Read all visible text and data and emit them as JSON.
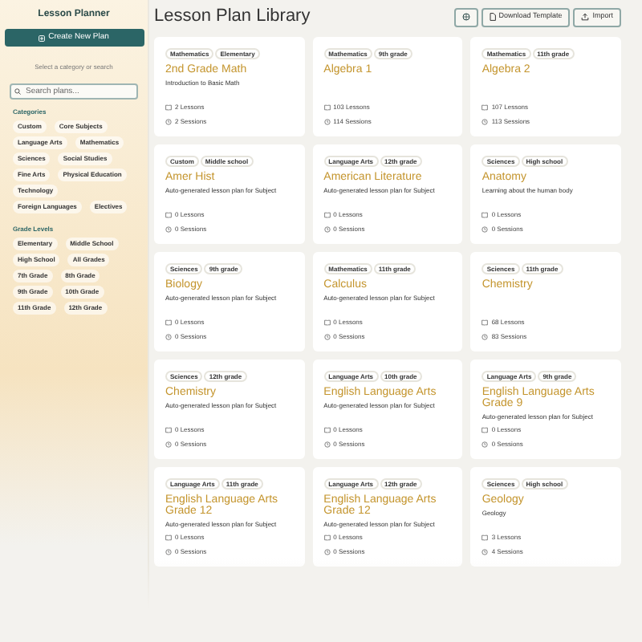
{
  "sidebar": {
    "title": "Lesson Planner",
    "create_button": "Create New Plan",
    "hint": "Select a category or search",
    "search": {
      "placeholder": "Search plans..."
    },
    "categories": {
      "heading": "Categories",
      "items": [
        "Custom",
        "Core Subjects",
        "Language Arts",
        "Mathematics",
        "Sciences",
        "Social Studies",
        "Fine Arts",
        "Physical Education",
        "Technology",
        "Foreign Languages",
        "Electives"
      ]
    },
    "grade_levels": {
      "heading": "Grade Levels",
      "items": [
        "Elementary",
        "Middle School",
        "High School",
        "All Grades",
        "7th Grade",
        "8th Grade",
        "9th Grade",
        "10th Grade",
        "11th Grade",
        "12th Grade"
      ]
    }
  },
  "header": {
    "title": "Lesson Plan Library",
    "buttons": [
      {
        "kind": "icon"
      },
      {
        "kind": "download",
        "label": "Download Template"
      },
      {
        "kind": "upload",
        "label": "Import"
      }
    ]
  },
  "plans": [
    {
      "tags": [
        "Mathematics",
        "Elementary"
      ],
      "title": "2nd Grade Math",
      "description": "Introduction to Basic Math",
      "lessons": "2 Lessons",
      "sessions": "2 Sessions"
    },
    {
      "tags": [
        "Mathematics",
        "9th grade"
      ],
      "title": "Algebra 1",
      "lessons": "103 Lessons",
      "sessions": "114 Sessions"
    },
    {
      "tags": [
        "Mathematics",
        "11th grade"
      ],
      "title": "Algebra 2",
      "lessons": "107 Lessons",
      "sessions": "113 Sessions"
    },
    {
      "tags": [
        "Custom",
        "Middle school"
      ],
      "title": "Amer Hist",
      "description": "Auto-generated lesson plan for Subject",
      "lessons": "0 Lessons",
      "sessions": "0 Sessions"
    },
    {
      "tags": [
        "Language Arts",
        "12th grade"
      ],
      "title": "American Literature",
      "description": "Auto-generated lesson plan for Subject",
      "lessons": "0 Lessons",
      "sessions": "0 Sessions"
    },
    {
      "tags": [
        "Sciences",
        "High school"
      ],
      "title": "Anatomy",
      "description": "Learning about the human body",
      "lessons": "0 Lessons",
      "sessions": "0 Sessions"
    },
    {
      "tags": [
        "Sciences",
        "9th grade"
      ],
      "title": "Biology",
      "description": "Auto-generated lesson plan for Subject",
      "lessons": "0 Lessons",
      "sessions": "0 Sessions"
    },
    {
      "tags": [
        "Mathematics",
        "11th grade"
      ],
      "title": "Calculus",
      "description": "Auto-generated lesson plan for Subject",
      "lessons": "0 Lessons",
      "sessions": "0 Sessions"
    },
    {
      "tags": [
        "Sciences",
        "11th grade"
      ],
      "title": "Chemistry",
      "lessons": "68 Lessons",
      "sessions": "83 Sessions"
    },
    {
      "tags": [
        "Sciences",
        "12th grade"
      ],
      "title": "Chemistry",
      "description": "Auto-generated lesson plan for Subject",
      "lessons": "0 Lessons",
      "sessions": "0 Sessions"
    },
    {
      "tags": [
        "Language Arts",
        "10th grade"
      ],
      "title": "English Language Arts",
      "description": "Auto-generated lesson plan for Subject",
      "lessons": "0 Lessons",
      "sessions": "0 Sessions"
    },
    {
      "tags": [
        "Language Arts",
        "9th grade"
      ],
      "title": "English Language Arts Grade 9",
      "description": "Auto-generated lesson plan for Subject",
      "lessons": "0 Lessons",
      "sessions": "0 Sessions"
    },
    {
      "tags": [
        "Language Arts",
        "11th grade"
      ],
      "title": "English Language Arts Grade 12",
      "description": "Auto-generated lesson plan for Subject",
      "lessons": "0 Lessons",
      "sessions": "0 Sessions"
    },
    {
      "tags": [
        "Language Arts",
        "12th grade"
      ],
      "title": "English Language Arts Grade 12",
      "description": "Auto-generated lesson plan for Subject",
      "lessons": "0 Lessons",
      "sessions": "0 Sessions"
    },
    {
      "tags": [
        "Sciences",
        "High school"
      ],
      "title": "Geology",
      "description": "Geology",
      "lessons": "3 Lessons",
      "sessions": "4 Sessions"
    }
  ]
}
